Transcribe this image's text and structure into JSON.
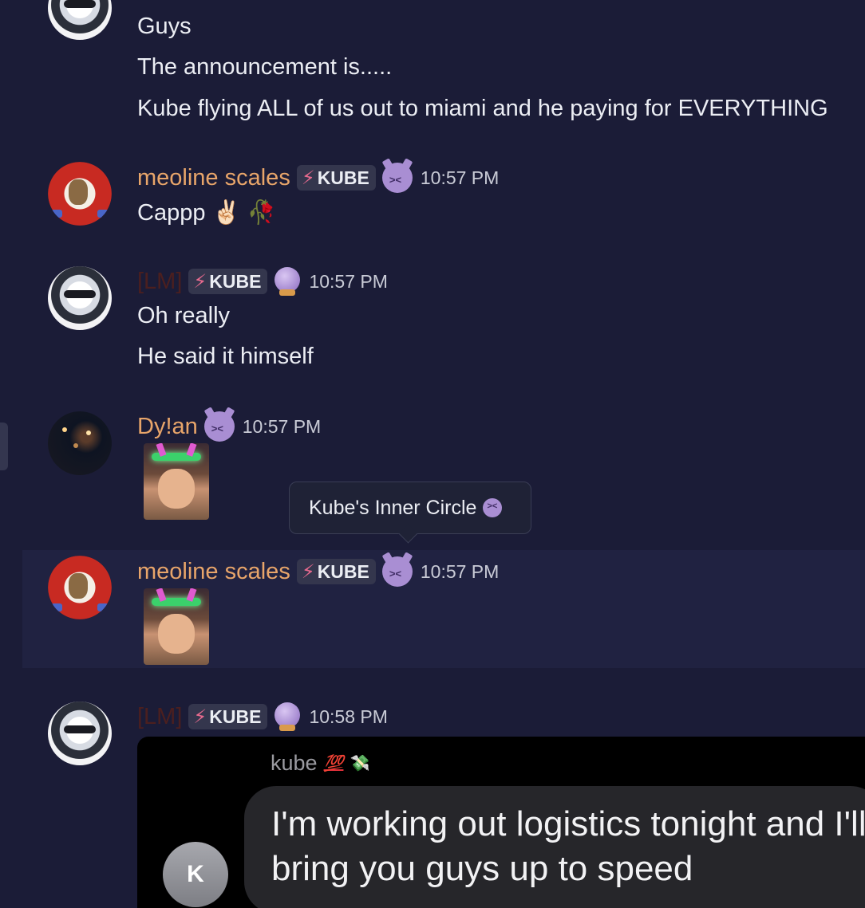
{
  "top_messages": [
    "Guys",
    "The announcement is.....",
    "Kube flying ALL of us out to miami and he paying for EVERYTHING"
  ],
  "messages": [
    {
      "username": "meoline scales",
      "tag": "KUBE",
      "role_icon": "angry-devil-emoji",
      "time": "10:57 PM",
      "lines": [
        "Cappp ✌🏻 🥀"
      ]
    },
    {
      "username": "[LM]",
      "tag": "KUBE",
      "role_icon": "crystal-ball-emoji",
      "time": "10:57 PM",
      "lines": [
        "Oh really",
        "He said it himself"
      ]
    },
    {
      "username": "Dy!an",
      "role_icon": "angry-devil-emoji",
      "time": "10:57 PM"
    },
    {
      "username": "meoline scales",
      "tag": "KUBE",
      "role_icon": "angry-devil-emoji",
      "time": "10:57 PM"
    },
    {
      "username": "[LM]",
      "tag": "KUBE",
      "role_icon": "crystal-ball-emoji",
      "time": "10:58 PM"
    }
  ],
  "tooltip": {
    "text": "Kube's Inner Circle"
  },
  "screenshot": {
    "sender": "kube",
    "sender_emoji_1": "💯",
    "sender_emoji_2": "💸",
    "avatar_initial": "K",
    "bubble_text": "I'm working out logistics tonight and I'll bring you guys up to speed"
  },
  "colors": {
    "background": "#1b1c37",
    "username": "#e8a56a",
    "lm_username": "#4b1f1f",
    "tag_bg": "#34364d"
  }
}
